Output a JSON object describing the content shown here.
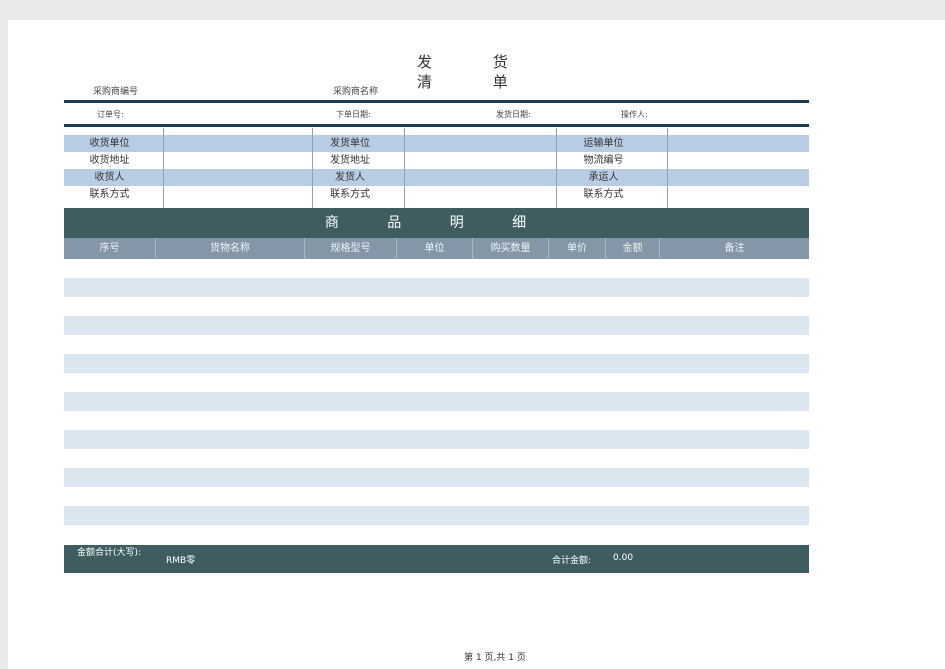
{
  "title": {
    "line1": "发 货",
    "line2": "清 单"
  },
  "meta": {
    "buyer_no_label": "采购商编号",
    "buyer_name_label": "采购商名称"
  },
  "order": {
    "order_no_label": "订单号:",
    "order_date_label": "下单日期:",
    "ship_date_label": "发货日期:",
    "operator_label": "操作人:"
  },
  "parties": {
    "receiver_unit": "收货单位",
    "receiver_address": "收货地址",
    "receiver_person": "收货人",
    "receiver_contact": "联系方式",
    "shipper_unit": "发货单位",
    "shipper_address": "发货地址",
    "shipper_person": "发货人",
    "shipper_contact": "联系方式",
    "carrier_unit": "运输单位",
    "tracking_no": "物流编号",
    "carrier_person": "承运人",
    "carrier_contact": "联系方式"
  },
  "section_title": "商 品 明 细",
  "columns": [
    "序号",
    "货物名称",
    "规格型号",
    "单位",
    "购买数量",
    "单价",
    "金额",
    "备注"
  ],
  "summary": {
    "amount_words_label": "金额合计(大写):",
    "amount_words_value": "RMB零",
    "total_label": "合计金额:",
    "total_value": "0.00"
  },
  "pagination": "第 1 页,共 1 页",
  "colors": {
    "band": "#3f5d60",
    "header": "#8397a8",
    "shade": "#b8cce4",
    "stripe": "#dce6f1",
    "rule": "#203a52"
  }
}
